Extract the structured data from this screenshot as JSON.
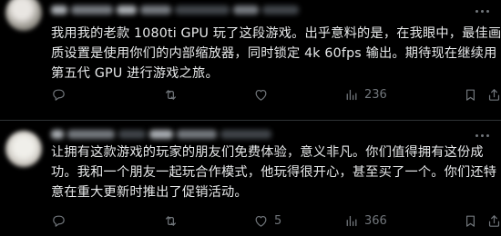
{
  "colors": {
    "background": "#000000",
    "text": "#e7e9ea",
    "muted": "#71767b",
    "divider": "#2f3336"
  },
  "tweets": [
    {
      "lines": [
        "我用我的老款 1080ti GPU 玩了这段游戏。出乎意料的是，在我眼中，最佳画",
        "质设置是使用你们的内部缩放器，同时锁定 4k 60fps 输出。期待现在继续用",
        "第五代 GPU 进行游戏之旅。"
      ],
      "reply_count": "",
      "repost_count": "",
      "like_count": "",
      "view_count": "236"
    },
    {
      "lines": [
        "让拥有这款游戏的玩家的朋友们免费体验，意义非凡。你们值得拥有这份成",
        "功。我和一个朋友一起玩合作模式，他玩得很开心，甚至买了一个。你们还特",
        "意在重大更新时推出了促销活动。"
      ],
      "reply_count": "",
      "repost_count": "",
      "like_count": "5",
      "view_count": "366"
    }
  ],
  "icons": {
    "avatar": "avatar",
    "more": "more-icon",
    "reply": "reply-icon",
    "repost": "repost-icon",
    "like": "like-icon",
    "views": "views-icon",
    "bookmark": "bookmark-icon",
    "share": "share-icon"
  }
}
